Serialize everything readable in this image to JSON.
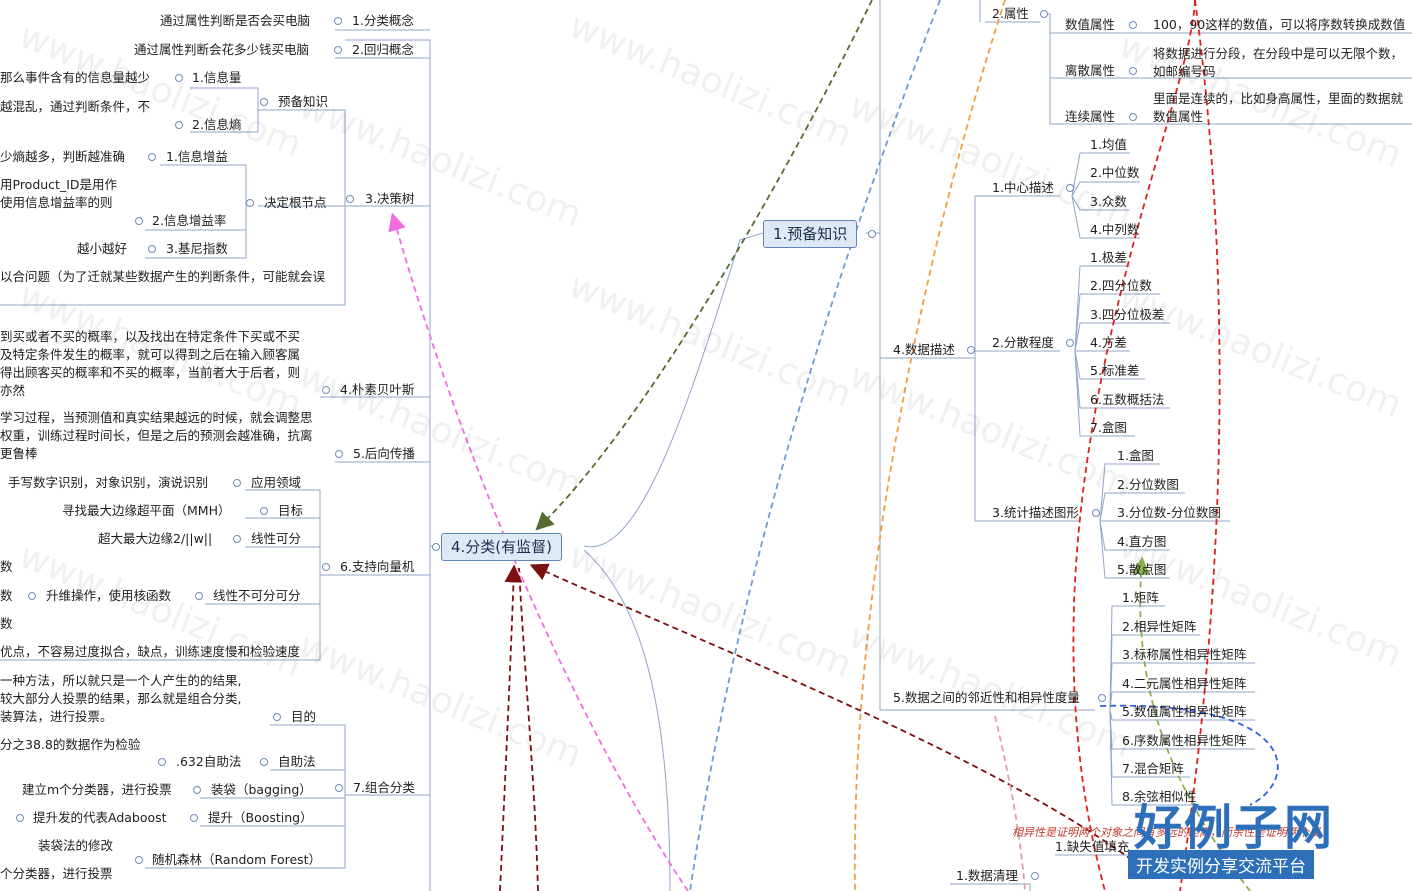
{
  "watermark": "www.haolizi.com",
  "logo": {
    "title": "好例子网",
    "subtitle": "开发实例分享交流平台"
  },
  "center_nodes": {
    "prereq": "1.预备知识",
    "classify": "4.分类(有监督)"
  },
  "left_branch": {
    "concept_classify": "1.分类概念",
    "concept_classify_desc": "通过属性判断是否会买电脑",
    "concept_regress": "2.回归概念",
    "concept_regress_desc": "通过属性判断会花多少钱买电脑",
    "decision_tree": "3.决策树",
    "prior_knowledge": "预备知识",
    "info_amount": "1.信息量",
    "info_amount_desc": "那么事件含有的信息量越少",
    "info_entropy": "2.信息熵",
    "info_entropy_desc": "越混乱，通过判断条件，不",
    "split_node": "决定根节点",
    "info_gain": "1.信息增益",
    "info_gain_desc": "少熵越多，判断越准确",
    "gain_ratio": "2.信息增益率",
    "gain_ratio_desc1": "用Product_ID是用作",
    "gain_ratio_desc2": "使用信息增益率的则",
    "gini": "3.基尼指数",
    "gini_desc": "越小越好",
    "overfit_desc": "以合问题（为了迁就某些数据产生的判断条件，可能就会误",
    "naive_bayes": "4.朴素贝叶斯",
    "nb_desc1": "到买或者不买的概率，以及找出在特定条件下买或不买",
    "nb_desc2": "及特定条件发生的概率，就可以得到之后在输入顾客属",
    "nb_desc3": "得出顾客买的概率和不买的概率，当前者大于后者，则",
    "nb_desc4": "亦然",
    "backprop": "5.后向传播",
    "bp_desc1": "学习过程，当预测值和真实结果越远的时候，就会调整思",
    "bp_desc2": "权重，训练过程时间长，但是之后的预测会越准确，抗离",
    "bp_desc3": "更鲁棒",
    "svm": "6.支持向量机",
    "svm_app": "应用领域",
    "svm_app_desc": "手写数字识别，对象识别，演说识别",
    "svm_goal": "目标",
    "svm_goal_desc": "寻找最大边缘超平面（MMH）",
    "svm_linear": "线性可分",
    "svm_linear_desc": "超大最大边缘2/||w||",
    "svm_nonlinear": "线性不可分可分",
    "svm_nonlinear_desc": "升维操作，使用核函数",
    "svm_frag1": "数",
    "svm_frag2": "数",
    "svm_frag3": "数",
    "svm_pros": "优点，不容易过度拟合，缺点，训练速度慢和检验速度",
    "ensemble": "7.组合分类",
    "ens_goal": "目的",
    "ens_desc1": "一种方法，所以就只是一个人产生的的结果,",
    "ens_desc2": "较大部分人投票的结果，那么就是组合分类,",
    "ens_desc3": "装算法，进行投票。",
    "bootstrap": "自助法",
    "bootstrap_632": ".632自助法",
    "bootstrap_desc": "分之38.8的数据作为检验",
    "bagging": "装袋（bagging）",
    "bagging_desc": "建立m个分类器，进行投票",
    "boosting": "提升（Boosting）",
    "boosting_desc": "提升发的代表Adaboost",
    "random_forest": "随机森林（Random Forest）",
    "rf_desc1": "装袋法的修改",
    "rf_desc2": "个分类器，进行投票"
  },
  "right_branch": {
    "attributes": "2.属性",
    "numeric_attr": "数值属性",
    "numeric_desc": "100，90这样的数值，可以将序数转换成数值",
    "discrete_attr": "离散属性",
    "discrete_desc1": "将数据进行分段，在分段中是可以无限个数，",
    "discrete_desc2": "如邮编号码",
    "continuous_attr": "连续属性",
    "continuous_desc1": "里面是连续的，比如身高属性，里面的数据就",
    "continuous_desc2": "数值属性",
    "data_desc": "4.数据描述",
    "central": "1.中心描述",
    "mean": "1.均值",
    "median": "2.中位数",
    "mode": "3.众数",
    "midrange": "4.中列数",
    "dispersion": "2.分散程度",
    "range": "1.极差",
    "quartile": "2.四分位数",
    "iqr": "3.四分位极差",
    "variance": "4.方差",
    "stdev": "5.标准差",
    "five_num": "6.五数概括法",
    "boxplot": "7.盒图",
    "graphs": "3.统计描述图形",
    "g_box": "1.盒图",
    "g_quantile": "2.分位数图",
    "g_qq": "3.分位数-分位数图",
    "g_hist": "4.直方图",
    "g_scatter": "5.散点图",
    "similarity": "5.数据之间的邻近性和相异性度量",
    "sim_matrix": "1.矩阵",
    "sim_dissim": "2.相异性矩阵",
    "sim_nominal": "3.标称属性相异性矩阵",
    "sim_binary": "4.二元属性相异性矩阵",
    "sim_numeric": "5.数值属性相异性矩阵",
    "sim_ordinal": "6.序数属性相异性矩阵",
    "sim_mixed": "7.混合矩阵",
    "sim_cosine": "8.余弦相似性",
    "sim_note": "相异性是证明两个对象之间有多远的距离，而余性是证明两个属",
    "missing": "1.缺失值填充",
    "cleaning": "1.数据清理"
  },
  "colors": {
    "connector": "#8fa6c8",
    "relation_olive": "#556b2f",
    "relation_blue": "#6f9bd1",
    "relation_orange": "#f0a040",
    "relation_red": "#e02020",
    "relation_pink": "#f06de0",
    "relation_maroon": "#7a1010",
    "relation_green": "#8bb050",
    "relation_rose": "#e0a0a0",
    "relation_darkblue": "#3060e0",
    "center_fill": "#dfe9f5",
    "center_border": "#5f86b8"
  }
}
